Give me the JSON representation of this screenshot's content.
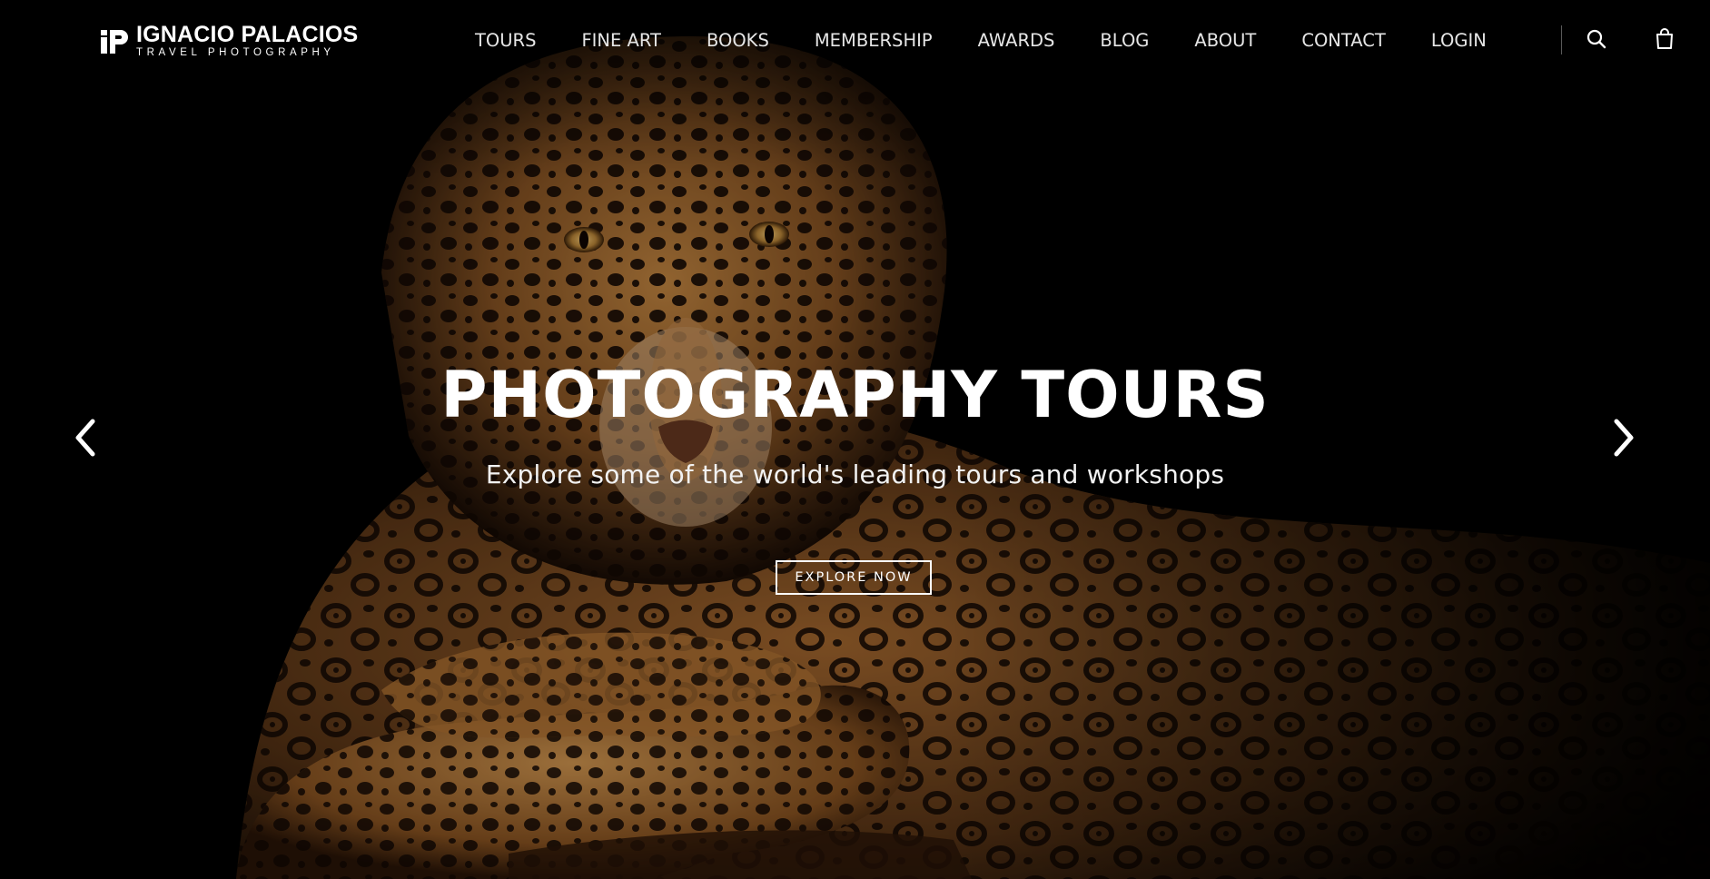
{
  "header": {
    "logo": {
      "mark": "iP",
      "name": "IGNACIO PALACIOS",
      "tagline": "TRAVEL PHOTOGRAPHY"
    },
    "nav": [
      {
        "label": "TOURS"
      },
      {
        "label": "FINE ART"
      },
      {
        "label": "BOOKS"
      },
      {
        "label": "MEMBERSHIP"
      },
      {
        "label": "AWARDS"
      },
      {
        "label": "BLOG"
      },
      {
        "label": "ABOUT"
      },
      {
        "label": "CONTACT"
      },
      {
        "label": "LOGIN"
      }
    ],
    "icons": {
      "search": "search-icon",
      "cart": "shopping-bag-icon"
    }
  },
  "hero": {
    "title": "PHOTOGRAPHY TOURS",
    "subtitle": "Explore some of the world's leading tours and workshops",
    "cta_label": "EXPLORE NOW",
    "image_subject": "jaguar",
    "prev_icon": "chevron-left-icon",
    "next_icon": "chevron-right-icon"
  },
  "colors": {
    "background": "#000000",
    "text": "#ffffff",
    "nav_text": "#e6e6e6"
  }
}
